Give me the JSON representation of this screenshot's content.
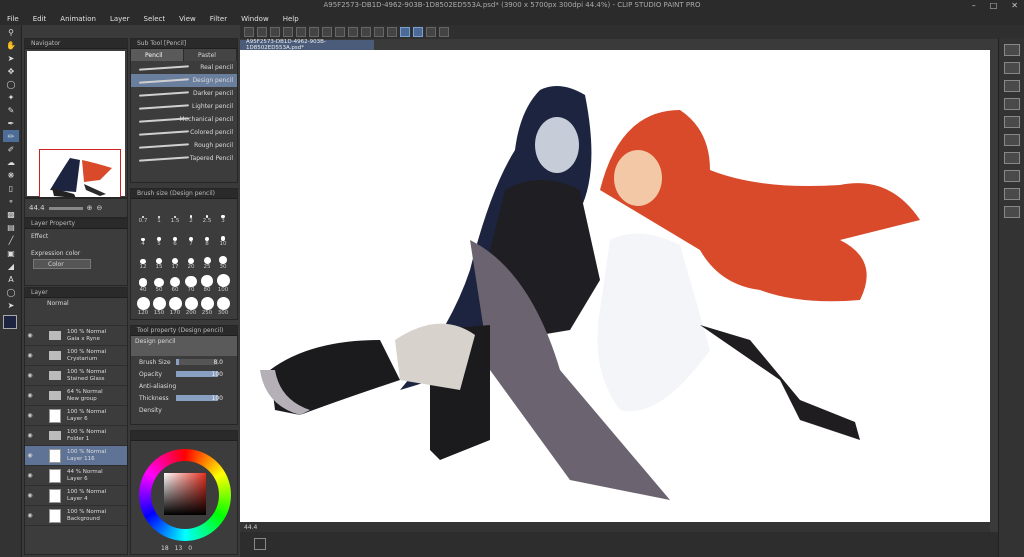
{
  "window": {
    "title": "A95F2573-DB1D-4962-903B-1D8502ED553A.psd* (3900 x 5700px 300dpi 44.4%) - CLIP STUDIO PAINT PRO",
    "controls": [
      "–",
      "□",
      "✕"
    ]
  },
  "menu": [
    "File",
    "Edit",
    "Animation",
    "Layer",
    "Select",
    "View",
    "Filter",
    "Window",
    "Help"
  ],
  "navigator": {
    "title": "Navigator",
    "zoom": "44.4"
  },
  "subtool": {
    "title": "Sub Tool [Pencil]",
    "tabs": [
      "Pencil",
      "Pastel"
    ],
    "brushes": [
      "Real pencil",
      "Design pencil",
      "Darker pencil",
      "Lighter pencil",
      "Mechanical pencil",
      "Colored pencil",
      "Rough pencil",
      "Tapered Pencil"
    ],
    "selected_index": 1
  },
  "brushsize": {
    "title": "Brush size (Design pencil)",
    "sizes": [
      "0.7",
      "1",
      "1.5",
      "2",
      "2.5",
      "3",
      "4",
      "5",
      "6",
      "7",
      "8",
      "10",
      "12",
      "15",
      "17",
      "20",
      "25",
      "30",
      "40",
      "50",
      "60",
      "70",
      "80",
      "100",
      "120",
      "150",
      "170",
      "200",
      "250",
      "300"
    ]
  },
  "toolprop": {
    "title": "Tool property (Design pencil)",
    "brush_name": "Design pencil",
    "rows": [
      {
        "label": "Brush Size",
        "value": "8.0"
      },
      {
        "label": "Opacity",
        "value": "100"
      },
      {
        "label": "Anti-aliasing",
        "value": ""
      },
      {
        "label": "Thickness",
        "value": "100"
      },
      {
        "label": "Density",
        "value": ""
      }
    ],
    "levels": {
      "brush_size": 0.08,
      "opacity": 1.0,
      "thickness": 1.0
    }
  },
  "layerprop": {
    "title": "Layer Property",
    "effect": "Effect",
    "expression_label": "Expression color",
    "expression_value": "Color"
  },
  "layers": {
    "title": "Layer",
    "blend": "Normal",
    "items": [
      {
        "line1": "100 % Normal",
        "line2": "Gaia x Ryne",
        "kind": "folder"
      },
      {
        "line1": "100 % Normal",
        "line2": "Crystarium",
        "kind": "folder"
      },
      {
        "line1": "100 % Normal",
        "line2": "Stained Glass",
        "kind": "folder"
      },
      {
        "line1": "64 % Normal",
        "line2": "New group",
        "kind": "folder"
      },
      {
        "line1": "100 % Normal",
        "line2": "Layer 6",
        "kind": "raster"
      },
      {
        "line1": "100 % Normal",
        "line2": "Folder 1",
        "kind": "folder"
      },
      {
        "line1": "100 % Normal",
        "line2": "Layer 116",
        "kind": "raster",
        "selected": true
      },
      {
        "line1": "44 % Normal",
        "line2": "Layer 6",
        "kind": "raster"
      },
      {
        "line1": "100 % Normal",
        "line2": "Layer 4",
        "kind": "raster"
      },
      {
        "line1": "100 % Normal",
        "line2": "Background",
        "kind": "raster"
      }
    ]
  },
  "colorwheel": {
    "h_value": "18",
    "s_value": "13",
    "v_value": "0"
  },
  "canvas": {
    "tab": "A95F2573-DB1D-4962-903B-1D8502ED553A.psd*",
    "zoom": "44.4"
  },
  "colors": {
    "accent": "#5e7396",
    "canvas": "#ffffff",
    "dark_hair": "#1d2440",
    "red_hair": "#d94a2a"
  }
}
